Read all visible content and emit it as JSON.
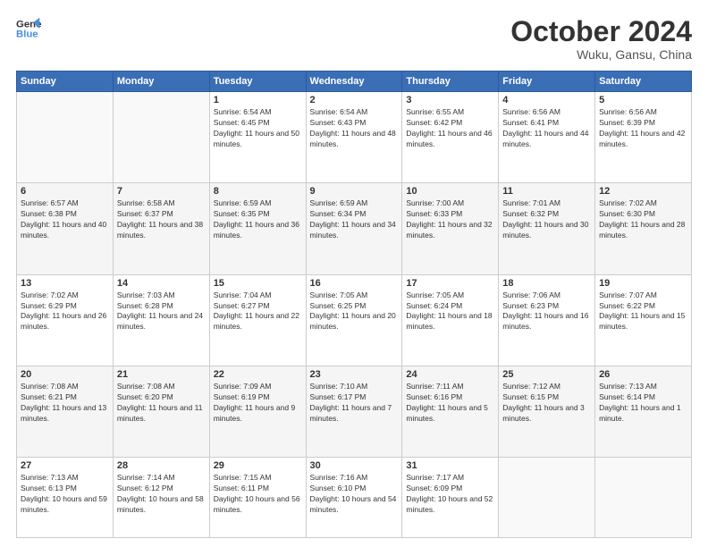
{
  "header": {
    "logo_line1": "General",
    "logo_line2": "Blue",
    "month": "October 2024",
    "location": "Wuku, Gansu, China"
  },
  "weekdays": [
    "Sunday",
    "Monday",
    "Tuesday",
    "Wednesday",
    "Thursday",
    "Friday",
    "Saturday"
  ],
  "weeks": [
    [
      {
        "day": "",
        "info": ""
      },
      {
        "day": "",
        "info": ""
      },
      {
        "day": "1",
        "info": "Sunrise: 6:54 AM\nSunset: 6:45 PM\nDaylight: 11 hours and 50 minutes."
      },
      {
        "day": "2",
        "info": "Sunrise: 6:54 AM\nSunset: 6:43 PM\nDaylight: 11 hours and 48 minutes."
      },
      {
        "day": "3",
        "info": "Sunrise: 6:55 AM\nSunset: 6:42 PM\nDaylight: 11 hours and 46 minutes."
      },
      {
        "day": "4",
        "info": "Sunrise: 6:56 AM\nSunset: 6:41 PM\nDaylight: 11 hours and 44 minutes."
      },
      {
        "day": "5",
        "info": "Sunrise: 6:56 AM\nSunset: 6:39 PM\nDaylight: 11 hours and 42 minutes."
      }
    ],
    [
      {
        "day": "6",
        "info": "Sunrise: 6:57 AM\nSunset: 6:38 PM\nDaylight: 11 hours and 40 minutes."
      },
      {
        "day": "7",
        "info": "Sunrise: 6:58 AM\nSunset: 6:37 PM\nDaylight: 11 hours and 38 minutes."
      },
      {
        "day": "8",
        "info": "Sunrise: 6:59 AM\nSunset: 6:35 PM\nDaylight: 11 hours and 36 minutes."
      },
      {
        "day": "9",
        "info": "Sunrise: 6:59 AM\nSunset: 6:34 PM\nDaylight: 11 hours and 34 minutes."
      },
      {
        "day": "10",
        "info": "Sunrise: 7:00 AM\nSunset: 6:33 PM\nDaylight: 11 hours and 32 minutes."
      },
      {
        "day": "11",
        "info": "Sunrise: 7:01 AM\nSunset: 6:32 PM\nDaylight: 11 hours and 30 minutes."
      },
      {
        "day": "12",
        "info": "Sunrise: 7:02 AM\nSunset: 6:30 PM\nDaylight: 11 hours and 28 minutes."
      }
    ],
    [
      {
        "day": "13",
        "info": "Sunrise: 7:02 AM\nSunset: 6:29 PM\nDaylight: 11 hours and 26 minutes."
      },
      {
        "day": "14",
        "info": "Sunrise: 7:03 AM\nSunset: 6:28 PM\nDaylight: 11 hours and 24 minutes."
      },
      {
        "day": "15",
        "info": "Sunrise: 7:04 AM\nSunset: 6:27 PM\nDaylight: 11 hours and 22 minutes."
      },
      {
        "day": "16",
        "info": "Sunrise: 7:05 AM\nSunset: 6:25 PM\nDaylight: 11 hours and 20 minutes."
      },
      {
        "day": "17",
        "info": "Sunrise: 7:05 AM\nSunset: 6:24 PM\nDaylight: 11 hours and 18 minutes."
      },
      {
        "day": "18",
        "info": "Sunrise: 7:06 AM\nSunset: 6:23 PM\nDaylight: 11 hours and 16 minutes."
      },
      {
        "day": "19",
        "info": "Sunrise: 7:07 AM\nSunset: 6:22 PM\nDaylight: 11 hours and 15 minutes."
      }
    ],
    [
      {
        "day": "20",
        "info": "Sunrise: 7:08 AM\nSunset: 6:21 PM\nDaylight: 11 hours and 13 minutes."
      },
      {
        "day": "21",
        "info": "Sunrise: 7:08 AM\nSunset: 6:20 PM\nDaylight: 11 hours and 11 minutes."
      },
      {
        "day": "22",
        "info": "Sunrise: 7:09 AM\nSunset: 6:19 PM\nDaylight: 11 hours and 9 minutes."
      },
      {
        "day": "23",
        "info": "Sunrise: 7:10 AM\nSunset: 6:17 PM\nDaylight: 11 hours and 7 minutes."
      },
      {
        "day": "24",
        "info": "Sunrise: 7:11 AM\nSunset: 6:16 PM\nDaylight: 11 hours and 5 minutes."
      },
      {
        "day": "25",
        "info": "Sunrise: 7:12 AM\nSunset: 6:15 PM\nDaylight: 11 hours and 3 minutes."
      },
      {
        "day": "26",
        "info": "Sunrise: 7:13 AM\nSunset: 6:14 PM\nDaylight: 11 hours and 1 minute."
      }
    ],
    [
      {
        "day": "27",
        "info": "Sunrise: 7:13 AM\nSunset: 6:13 PM\nDaylight: 10 hours and 59 minutes."
      },
      {
        "day": "28",
        "info": "Sunrise: 7:14 AM\nSunset: 6:12 PM\nDaylight: 10 hours and 58 minutes."
      },
      {
        "day": "29",
        "info": "Sunrise: 7:15 AM\nSunset: 6:11 PM\nDaylight: 10 hours and 56 minutes."
      },
      {
        "day": "30",
        "info": "Sunrise: 7:16 AM\nSunset: 6:10 PM\nDaylight: 10 hours and 54 minutes."
      },
      {
        "day": "31",
        "info": "Sunrise: 7:17 AM\nSunset: 6:09 PM\nDaylight: 10 hours and 52 minutes."
      },
      {
        "day": "",
        "info": ""
      },
      {
        "day": "",
        "info": ""
      }
    ]
  ]
}
